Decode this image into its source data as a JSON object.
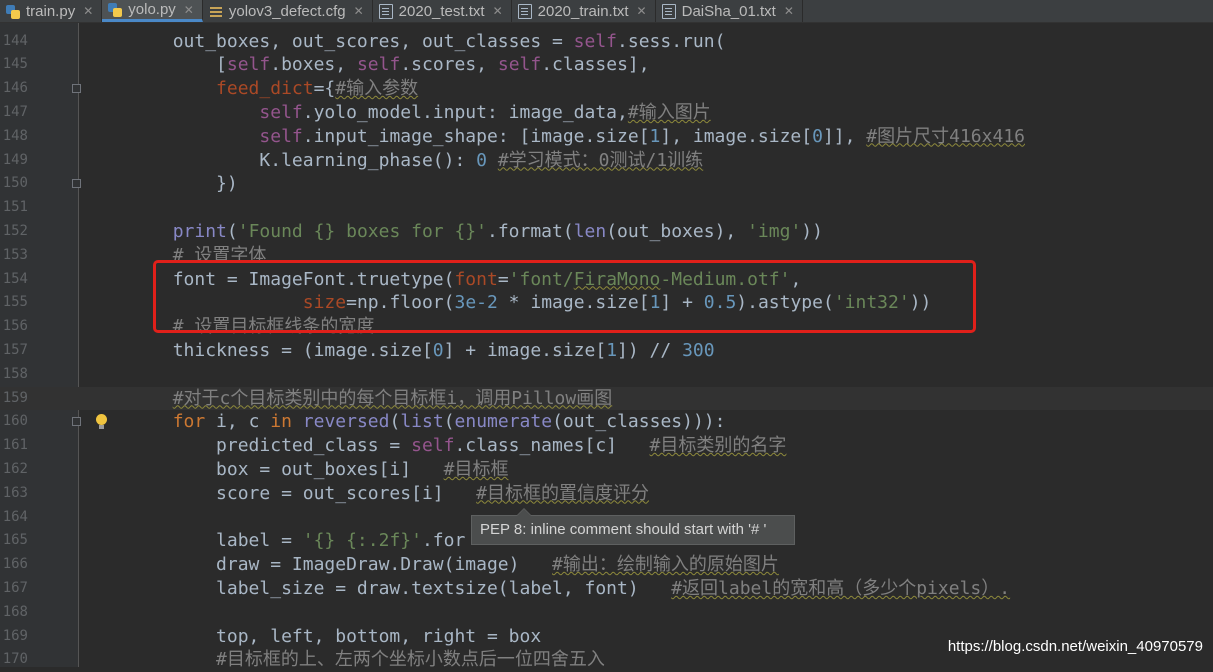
{
  "tabs": [
    {
      "label": "train.py",
      "icon": "python-file-icon",
      "active": false
    },
    {
      "label": "yolo.py",
      "icon": "python-file-icon",
      "active": true
    },
    {
      "label": "yolov3_defect.cfg",
      "icon": "config-file-icon",
      "active": false
    },
    {
      "label": "2020_test.txt",
      "icon": "text-file-icon",
      "active": false
    },
    {
      "label": "2020_train.txt",
      "icon": "text-file-icon",
      "active": false
    },
    {
      "label": "DaiSha_01.txt",
      "icon": "text-file-icon",
      "active": false
    }
  ],
  "close_glyph": "✕",
  "lines": [
    {
      "num": "144",
      "tokens": [
        {
          "t": "        out_boxes, out_scores, out_classes = "
        },
        {
          "t": "self",
          "c": "slf"
        },
        {
          "t": ".sess.run("
        }
      ]
    },
    {
      "num": "145",
      "tokens": [
        {
          "t": "            ["
        },
        {
          "t": "self",
          "c": "slf"
        },
        {
          "t": ".boxes, "
        },
        {
          "t": "self",
          "c": "slf"
        },
        {
          "t": ".scores, "
        },
        {
          "t": "self",
          "c": "slf"
        },
        {
          "t": ".classes],"
        }
      ]
    },
    {
      "num": "146",
      "fold": true,
      "tokens": [
        {
          "t": "            "
        },
        {
          "t": "feed_dict",
          "c": "prm"
        },
        {
          "t": "={"
        },
        {
          "t": "#输入参数",
          "c": "cm wavy"
        }
      ]
    },
    {
      "num": "147",
      "tokens": [
        {
          "t": "                "
        },
        {
          "t": "self",
          "c": "slf"
        },
        {
          "t": ".yolo_model.input: image_data,"
        },
        {
          "t": "#输入图片",
          "c": "cm wavy"
        }
      ]
    },
    {
      "num": "148",
      "tokens": [
        {
          "t": "                "
        },
        {
          "t": "self",
          "c": "slf"
        },
        {
          "t": ".input_image_shape: [image.size["
        },
        {
          "t": "1",
          "c": "num"
        },
        {
          "t": "], image.size["
        },
        {
          "t": "0",
          "c": "num"
        },
        {
          "t": "]], "
        },
        {
          "t": "#图片尺寸416x416",
          "c": "cm wavy"
        }
      ]
    },
    {
      "num": "149",
      "tokens": [
        {
          "t": "                K.learning_phase(): "
        },
        {
          "t": "0",
          "c": "num"
        },
        {
          "t": " "
        },
        {
          "t": "#学习模式：0测试/1训练",
          "c": "cm wavy"
        }
      ]
    },
    {
      "num": "150",
      "fold": true,
      "tokens": [
        {
          "t": "            })"
        }
      ]
    },
    {
      "num": "151",
      "tokens": []
    },
    {
      "num": "152",
      "tokens": [
        {
          "t": "        "
        },
        {
          "t": "print",
          "c": "bi"
        },
        {
          "t": "("
        },
        {
          "t": "'Found {} boxes for {}'",
          "c": "str"
        },
        {
          "t": ".format("
        },
        {
          "t": "len",
          "c": "bi"
        },
        {
          "t": "(out_boxes), "
        },
        {
          "t": "'img'",
          "c": "str"
        },
        {
          "t": "))"
        }
      ]
    },
    {
      "num": "153",
      "tokens": [
        {
          "t": "        "
        },
        {
          "t": "# 设置字体",
          "c": "cm"
        }
      ]
    },
    {
      "num": "154",
      "tokens": [
        {
          "t": "        font = ImageFont.truetype("
        },
        {
          "t": "font",
          "c": "prm"
        },
        {
          "t": "="
        },
        {
          "t": "'font/",
          "c": "str"
        },
        {
          "t": "FiraMono",
          "c": "str wavy"
        },
        {
          "t": "-Medium.otf'",
          "c": "str"
        },
        {
          "t": ","
        }
      ]
    },
    {
      "num": "155",
      "tokens": [
        {
          "t": "                    "
        },
        {
          "t": "size",
          "c": "prm"
        },
        {
          "t": "=np.floor("
        },
        {
          "t": "3e-2",
          "c": "num"
        },
        {
          "t": " * image.size["
        },
        {
          "t": "1",
          "c": "num"
        },
        {
          "t": "] + "
        },
        {
          "t": "0.5",
          "c": "num"
        },
        {
          "t": ").astype("
        },
        {
          "t": "'int32'",
          "c": "str"
        },
        {
          "t": "))"
        }
      ]
    },
    {
      "num": "156",
      "tokens": [
        {
          "t": "        "
        },
        {
          "t": "# 设置目标框线条的宽度",
          "c": "cm"
        }
      ]
    },
    {
      "num": "157",
      "tokens": [
        {
          "t": "        thickness = (image.size["
        },
        {
          "t": "0",
          "c": "num"
        },
        {
          "t": "] + image.size["
        },
        {
          "t": "1",
          "c": "num"
        },
        {
          "t": "]) // "
        },
        {
          "t": "300",
          "c": "num"
        }
      ]
    },
    {
      "num": "158",
      "tokens": []
    },
    {
      "num": "159",
      "caret": true,
      "tokens": [
        {
          "t": "        "
        },
        {
          "t": "#对于c个目标类别中的每个目标框i，调用Pillow画图",
          "c": "cm wavy"
        }
      ]
    },
    {
      "num": "160",
      "fold": true,
      "bulb": true,
      "tokens": [
        {
          "t": "        "
        },
        {
          "t": "for",
          "c": "kw"
        },
        {
          "t": " i, c "
        },
        {
          "t": "in",
          "c": "kw"
        },
        {
          "t": " "
        },
        {
          "t": "reversed",
          "c": "bi"
        },
        {
          "t": "("
        },
        {
          "t": "list",
          "c": "bi"
        },
        {
          "t": "("
        },
        {
          "t": "enumerate",
          "c": "bi"
        },
        {
          "t": "(out_classes))):"
        }
      ]
    },
    {
      "num": "161",
      "tokens": [
        {
          "t": "            predicted_class = "
        },
        {
          "t": "self",
          "c": "slf"
        },
        {
          "t": ".class_names[c]   "
        },
        {
          "t": "#目标类别的名字",
          "c": "cm wavy"
        }
      ]
    },
    {
      "num": "162",
      "tokens": [
        {
          "t": "            box = out_boxes[i]   "
        },
        {
          "t": "#目标框",
          "c": "cm wavy"
        }
      ]
    },
    {
      "num": "163",
      "tokens": [
        {
          "t": "            score = out_scores[i]   "
        },
        {
          "t": "#目标框的置信度评分",
          "c": "cm wavy"
        }
      ]
    },
    {
      "num": "164",
      "tokens": []
    },
    {
      "num": "165",
      "tokens": [
        {
          "t": "            label = "
        },
        {
          "t": "'{} {:.2f}'",
          "c": "str"
        },
        {
          "t": ".for"
        }
      ]
    },
    {
      "num": "166",
      "tokens": [
        {
          "t": "            draw = ImageDraw.Draw(image)   "
        },
        {
          "t": "#输出：绘制输入的原始图片",
          "c": "cm wavy"
        }
      ]
    },
    {
      "num": "167",
      "tokens": [
        {
          "t": "            label_size = draw.textsize(label, font)   "
        },
        {
          "t": "#返回label的宽和高（多少个pixels）.",
          "c": "cm wavy"
        }
      ]
    },
    {
      "num": "168",
      "tokens": []
    },
    {
      "num": "169",
      "tokens": [
        {
          "t": "            top, left, bottom, right = box"
        }
      ]
    },
    {
      "num": "170",
      "tokens": [
        {
          "t": "            "
        },
        {
          "t": "#目标框的上、左两个坐标小数点后一位四舍五入",
          "c": "cm"
        }
      ]
    }
  ],
  "tooltip": {
    "text": "PEP 8: inline comment should start with '# '"
  },
  "watermark": "https://blog.csdn.net/weixin_40970579",
  "colors": {
    "highlight_box": "#e0201a",
    "background": "#2b2b2b",
    "gutter": "#313335"
  }
}
